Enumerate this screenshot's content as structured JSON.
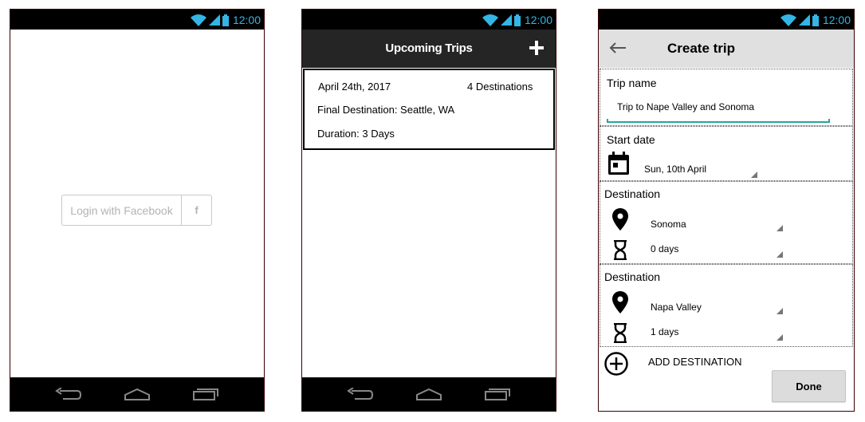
{
  "status_bar": {
    "time": "12:00"
  },
  "login_screen": {
    "facebook_button_label": "Login with Facebook",
    "facebook_glyph": "f"
  },
  "trips_screen": {
    "title": "Upcoming Trips",
    "trip": {
      "date": "April 24th, 2017",
      "destinations": "4 Destinations",
      "final_destination": "Final Destination: Seattle, WA",
      "duration": "Duration: 3 Days"
    }
  },
  "create_trip_screen": {
    "title": "Create trip",
    "trip_name_label": "Trip name",
    "trip_name_value": "Trip to Nape Valley and Sonoma",
    "start_date_label": "Start date",
    "start_date_value": "Sun, 10th April",
    "destinations": [
      {
        "label": "Destination",
        "place": "Sonoma",
        "days": "0 days"
      },
      {
        "label": "Destination",
        "place": "Napa Valley",
        "days": "1 days"
      }
    ],
    "add_destination_label": "ADD DESTINATION",
    "done_label": "Done"
  },
  "colors": {
    "status_time": "#33b5e5",
    "trips_titlebar": "#252525",
    "create_titlebar": "#e0e0e0",
    "accent_underline": "#26a69a"
  }
}
